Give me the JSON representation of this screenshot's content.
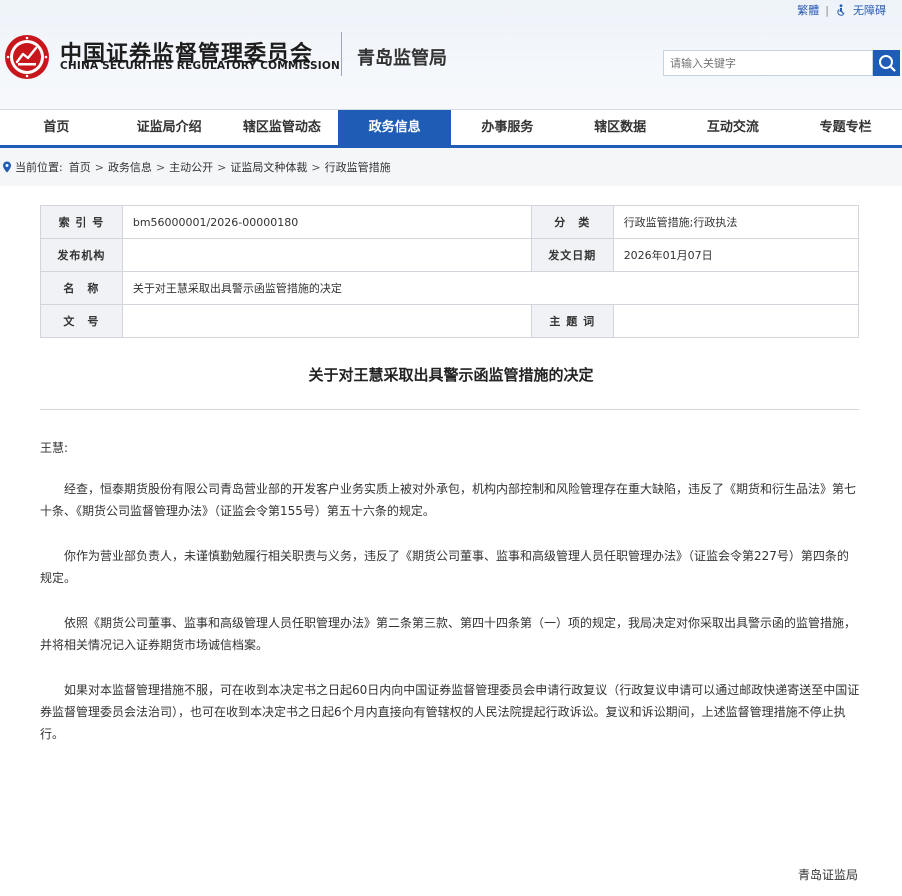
{
  "top_links": {
    "traditional": "繁體",
    "separator": "|",
    "accessibility": "无障碍"
  },
  "header": {
    "name_cn": "中国证券监督管理委员会",
    "name_en": "CHINA SECURITIES REGULATORY COMMISSION",
    "bureau": "青岛监管局"
  },
  "search": {
    "placeholder": "请输入关键字"
  },
  "nav": {
    "items": [
      "首页",
      "证监局介绍",
      "辖区监管动态",
      "政务信息",
      "办事服务",
      "辖区数据",
      "互动交流",
      "专题专栏"
    ],
    "active": "政务信息"
  },
  "breadcrumb": {
    "prefix": "当前位置:",
    "items": [
      "首页",
      "政务信息",
      "主动公开",
      "证监局文种体裁",
      "行政监管措施"
    ],
    "separator": ">"
  },
  "meta": {
    "index_no_label": "索 引 号",
    "index_no": "bm56000001/2026-00000180",
    "category_label": "分　类",
    "category": "行政监管措施;行政执法",
    "issuer_label": "发布机构",
    "issuer": "",
    "date_label": "发文日期",
    "date": "2026年01月07日",
    "name_label": "名　称",
    "name": "关于对王慧采取出具警示函监管措施的决定",
    "doc_no_label": "文　号",
    "doc_no": "",
    "subject_label": "主 题 词",
    "subject": ""
  },
  "document": {
    "title": "关于对王慧采取出具警示函监管措施的决定",
    "salutation": "王慧:",
    "paragraphs": [
      "经查，恒泰期货股份有限公司青岛营业部的开发客户业务实质上被对外承包，机构内部控制和风险管理存在重大缺陷，违反了《期货和衍生品法》第七十条、《期货公司监督管理办法》（证监会令第155号）第五十六条的规定。",
      "你作为营业部负责人，未谨慎勤勉履行相关职责与义务，违反了《期货公司董事、监事和高级管理人员任职管理办法》（证监会令第227号）第四条的规定。",
      "依照《期货公司董事、监事和高级管理人员任职管理办法》第二条第三款、第四十四条第（一）项的规定，我局决定对你采取出具警示函的监管措施，并将相关情况记入证券期货市场诚信档案。",
      "如果对本监督管理措施不服，可在收到本决定书之日起60日内向中国证券监督管理委员会申请行政复议（行政复议申请可以通过邮政快递寄送至中国证券监督管理委员会法治司），也可在收到本决定书之日起6个月内直接向有管辖权的人民法院提起行政诉讼。复议和诉讼期间，上述监督管理措施不停止执行。"
    ],
    "signature": "青岛证监局"
  },
  "colors": {
    "brand_blue": "#1e5cb5",
    "logo_red": "#c8161d"
  }
}
